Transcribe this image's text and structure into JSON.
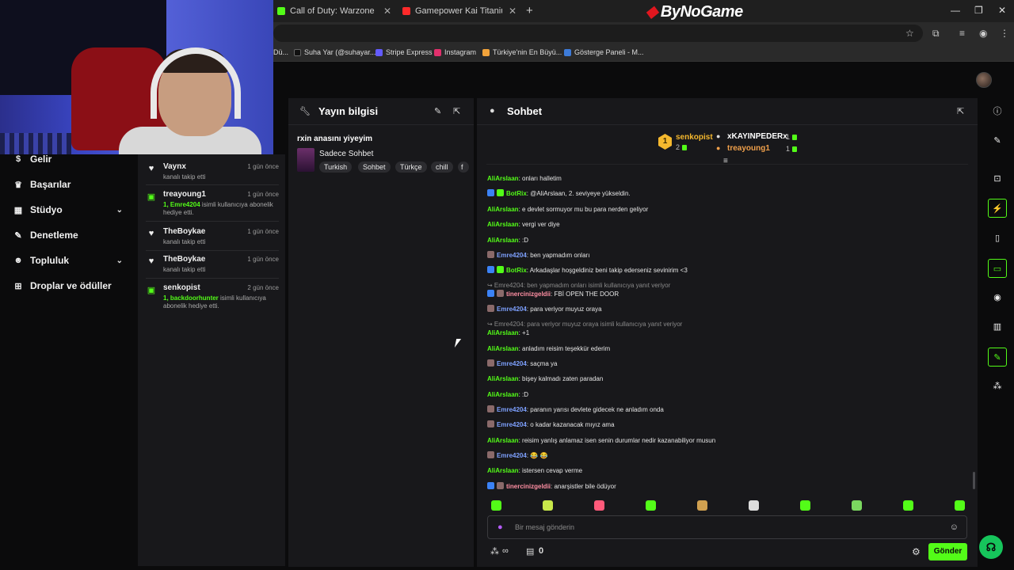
{
  "browser": {
    "tabs": [
      {
        "label": "Call of Duty: Warzone Streaming",
        "color": "#53fc18"
      },
      {
        "label": "Gamepower Kai Titanium Ultra",
        "color": "#ff2a2a"
      }
    ],
    "brand": "ByNoGame",
    "bookmarks": [
      {
        "label": "Dü...",
        "color": "#888888"
      },
      {
        "label": "Suha Yar (@suhayar....",
        "color": "#222222"
      },
      {
        "label": "Stripe Express",
        "color": "#635bff"
      },
      {
        "label": "Instagram",
        "color": "#e1306c"
      },
      {
        "label": "Türkiye'nin En Büyü...",
        "color": "#f2a33a"
      },
      {
        "label": "Gösterge Paneli - M...",
        "color": "#3d7bd9"
      }
    ]
  },
  "sidebar": {
    "items": [
      {
        "label": "Gelir",
        "icon": "dollar-icon",
        "glyph": "$"
      },
      {
        "label": "Başarılar",
        "icon": "trophy-icon",
        "glyph": "♛"
      },
      {
        "label": "Stüdyo",
        "icon": "studio-icon",
        "glyph": "▦",
        "chevron": "⌄"
      },
      {
        "label": "Denetleme",
        "icon": "wrench-icon",
        "glyph": "✎"
      },
      {
        "label": "Topluluk",
        "icon": "community-icon",
        "glyph": "☻",
        "chevron": "⌄"
      },
      {
        "label": "Droplar ve ödüller",
        "icon": "drops-icon",
        "glyph": "⊞"
      }
    ]
  },
  "activity": {
    "items": [
      {
        "name": "Vaynx",
        "time": "1 gün önce",
        "desc": "kanalı takip etti",
        "icon": "heart-icon"
      },
      {
        "name": "treayoung1",
        "time": "1 gün önce",
        "desc_highlight": "1, Emre4204",
        "desc": " isimli kullanıcıya abonelik hediye etti.",
        "icon": "gift-icon"
      },
      {
        "name": "TheBoykae",
        "time": "1 gün önce",
        "desc": "kanalı takip etti",
        "icon": "heart-icon"
      },
      {
        "name": "TheBoykae",
        "time": "1 gün önce",
        "desc": "kanalı takip etti",
        "icon": "heart-icon"
      },
      {
        "name": "senkopist",
        "time": "2 gün önce",
        "desc_highlight": "1, backdoorhunter",
        "desc": " isimli kullanıcıya abonelik hediye etti.",
        "icon": "gift-icon"
      }
    ]
  },
  "stream_info": {
    "title": "Yayın bilgisi",
    "stream_title": "rxin anasını yiyeyim",
    "category": "Sadece Sohbet",
    "tags": [
      "Turkish",
      "Sohbet",
      "Türkçe",
      "chill",
      "f"
    ]
  },
  "chat": {
    "title": "Sohbet",
    "leaderboard": [
      {
        "rank": "1",
        "name": "senkopist",
        "count": "2",
        "color": "#f5b82e"
      },
      {
        "name": "xKAYINPEDERx",
        "count": "1",
        "color": "#ffffff"
      },
      {
        "name": "treayoung1",
        "count": "1",
        "color": "#f0a04b"
      }
    ],
    "messages": [
      {
        "user": "AliArslaan",
        "cls": "c-ali",
        "text": "onları halletim"
      },
      {
        "user": "BotRix",
        "cls": "c-bot",
        "text": "@AliArslaan, 2. seviyeye yükseldin.",
        "badges": [
          "#3b82f6",
          "#53fc18"
        ]
      },
      {
        "user": "AliArslaan",
        "cls": "c-ali",
        "text": "e devlet sormuyor mu bu para nerden geliyor"
      },
      {
        "user": "AliArslaan",
        "cls": "c-ali",
        "text": "vergi ver diye"
      },
      {
        "user": "AliArslaan",
        "cls": "c-ali",
        "text": ":D"
      },
      {
        "user": "Emre4204",
        "cls": "c-emre",
        "text": "ben yapmadım onları",
        "badges": [
          "#8a6a6a"
        ]
      },
      {
        "user": "BotRix",
        "cls": "c-bot",
        "text": "Arkadaşlar hoşgeldiniz beni takip ederseniz sevinirim <3",
        "badges": [
          "#3b82f6",
          "#53fc18"
        ]
      },
      {
        "reply": "↪ Emre4204: ben yapmadım onları isimli kullanıcıya yanıt veriyor"
      },
      {
        "user": "tinercinizgeldii",
        "cls": "c-tin",
        "text": "FBİ OPEN THE DOOR",
        "badges": [
          "#3b82f6",
          "#8a6a6a"
        ]
      },
      {
        "user": "Emre4204",
        "cls": "c-emre",
        "text": "para veriyor muyuz oraya",
        "badges": [
          "#8a6a6a"
        ]
      },
      {
        "reply": "↪ Emre4204: para veriyor muyuz oraya isimli kullanıcıya yanıt veriyor"
      },
      {
        "user": "AliArslaan",
        "cls": "c-ali",
        "text": "+1"
      },
      {
        "user": "AliArslaan",
        "cls": "c-ali",
        "text": "anladım reisim teşekkür ederim"
      },
      {
        "user": "Emre4204",
        "cls": "c-emre",
        "text": "saçma ya",
        "badges": [
          "#8a6a6a"
        ]
      },
      {
        "user": "AliArslaan",
        "cls": "c-ali",
        "text": "bişey kalmadı zaten paradan"
      },
      {
        "user": "AliArslaan",
        "cls": "c-ali",
        "text": ":D"
      },
      {
        "user": "Emre4204",
        "cls": "c-emre",
        "text": "paranın yarısı devlete gidecek ne anladım onda",
        "badges": [
          "#8a6a6a"
        ]
      },
      {
        "user": "Emre4204",
        "cls": "c-emre",
        "text": "o kadar kazanacak mıyız ama",
        "badges": [
          "#8a6a6a"
        ]
      },
      {
        "user": "AliArslaan",
        "cls": "c-ali",
        "text": "reisim yanlış anlamaz isen senin durumlar nedir kazanabiliyor musun"
      },
      {
        "user": "Emre4204",
        "cls": "c-emre",
        "text": "😂 😂",
        "badges": [
          "#8a6a6a"
        ]
      },
      {
        "user": "AliArslaan",
        "cls": "c-ali",
        "text": "istersen cevap verme"
      },
      {
        "user": "tinercinizgeldii",
        "cls": "c-tin",
        "text": "anarşistler bile ödüyor",
        "badges": [
          "#3b82f6",
          "#8a6a6a"
        ]
      }
    ],
    "emote_colors": [
      "#53fc18",
      "#c8e84a",
      "#ff5a7a",
      "#53fc18",
      "#d0a050",
      "#dddddd",
      "#53fc18",
      "#7bd860",
      "#53fc18",
      "#53fc18"
    ],
    "input_placeholder": "Bir mesaj gönderin",
    "send_label": "Gönder",
    "kicks_count": "0",
    "points_label": "∞"
  },
  "accent_color": "#53fc18"
}
